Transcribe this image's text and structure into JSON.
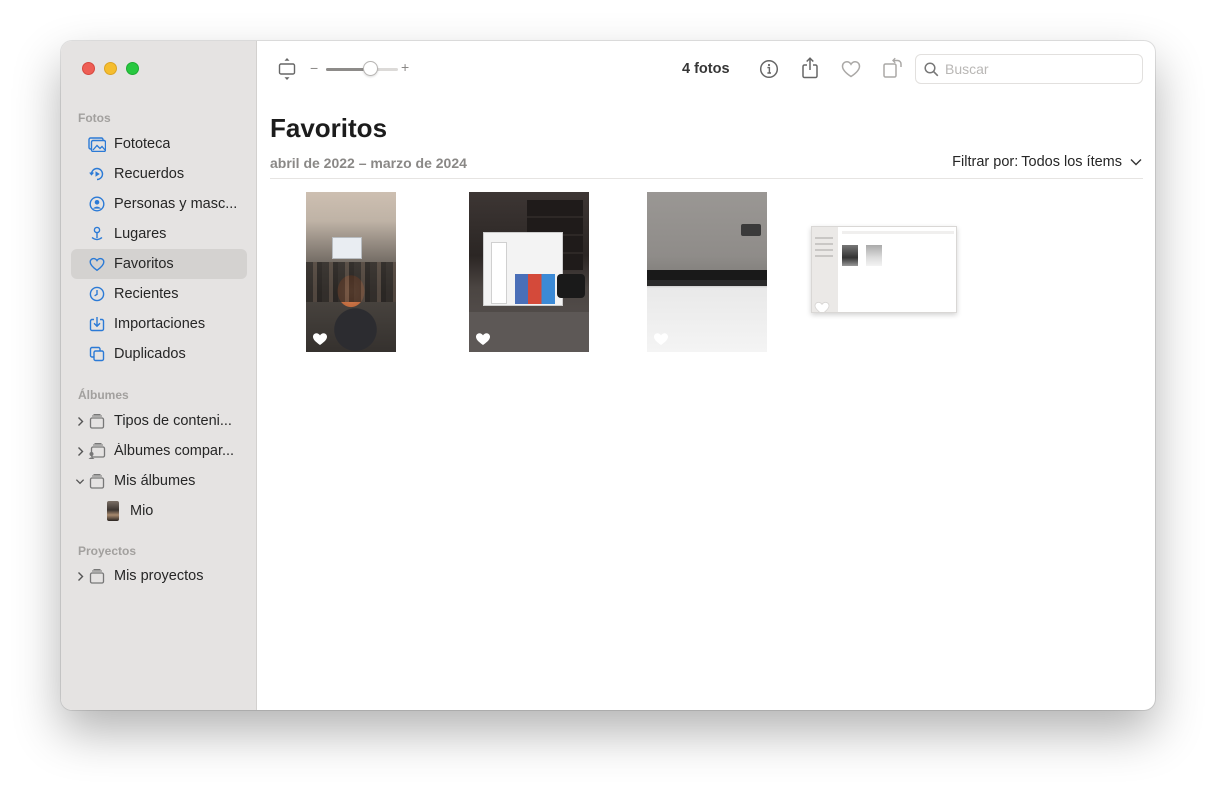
{
  "window": {
    "traffic_lights": [
      "close",
      "minimize",
      "zoom"
    ]
  },
  "sidebar": {
    "sections": [
      {
        "title": "Fotos",
        "items": [
          {
            "label": "Fototeca",
            "icon": "photo-library-icon"
          },
          {
            "label": "Recuerdos",
            "icon": "memories-icon"
          },
          {
            "label": "Personas y masc...",
            "icon": "people-icon"
          },
          {
            "label": "Lugares",
            "icon": "places-icon"
          },
          {
            "label": "Favoritos",
            "icon": "heart-icon",
            "selected": true
          },
          {
            "label": "Recientes",
            "icon": "clock-icon"
          },
          {
            "label": "Importaciones",
            "icon": "import-icon"
          },
          {
            "label": "Duplicados",
            "icon": "duplicates-icon"
          }
        ]
      },
      {
        "title": "Álbumes",
        "items": [
          {
            "label": "Tipos de conteni...",
            "icon": "album-stack-icon",
            "chevron": "right"
          },
          {
            "label": "Álbumes compar...",
            "icon": "shared-album-icon",
            "chevron": "right"
          },
          {
            "label": "Mis álbumes",
            "icon": "album-stack-icon",
            "chevron": "down"
          },
          {
            "label": "Mio",
            "icon": "album-thumbnail",
            "indent": 2
          }
        ]
      },
      {
        "title": "Proyectos",
        "items": [
          {
            "label": "Mis proyectos",
            "icon": "album-stack-icon",
            "chevron": "right"
          }
        ]
      }
    ]
  },
  "toolbar": {
    "zoom_minus": "−",
    "zoom_plus": "+",
    "zoom_level": 0.62,
    "photo_count": "4 fotos",
    "search_placeholder": "Buscar",
    "icons": [
      "aspect-icon",
      "info-icon",
      "share-icon",
      "heart-outline-icon",
      "rotate-icon",
      "search-icon"
    ]
  },
  "main": {
    "title": "Favoritos",
    "date_range": "abril de 2022 – marzo de 2024",
    "filter_label": "Filtrar por:",
    "filter_value": "Todos los ítems",
    "photos": [
      {
        "subject": "classroom",
        "favorite": true
      },
      {
        "subject": "ps5-box",
        "favorite": true
      },
      {
        "subject": "kitchen-counter",
        "favorite": true
      },
      {
        "subject": "screenshot",
        "favorite": true
      }
    ]
  },
  "colors": {
    "sidebar_bg": "#e5e3e2",
    "selected_row": "#d4d2d0",
    "accent_blue": "#2b7ad6",
    "close": "#ee5e55",
    "minimize": "#f5bd2e",
    "zoom": "#28c840"
  }
}
